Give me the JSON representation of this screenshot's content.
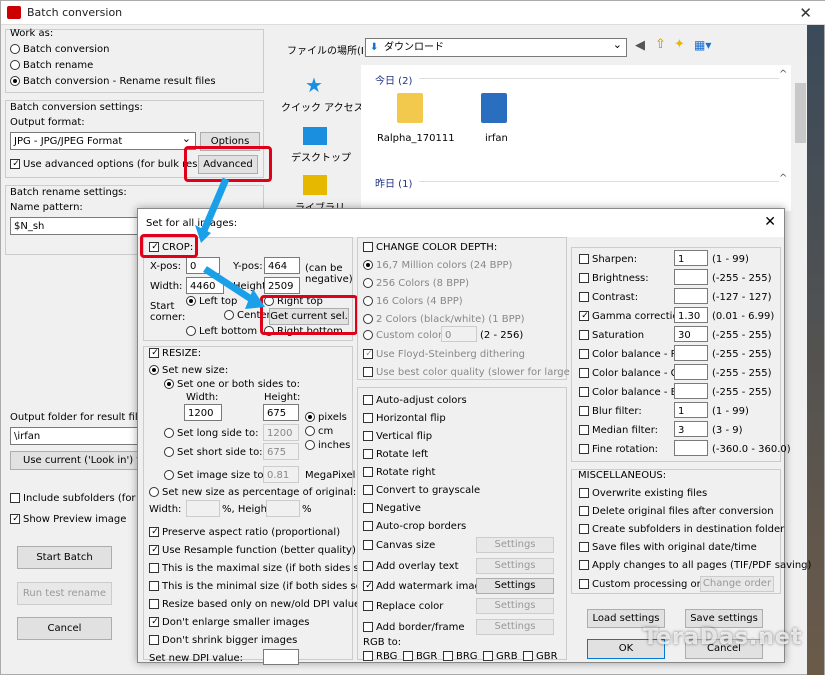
{
  "window": {
    "title": "Batch conversion"
  },
  "main": {
    "work_as": {
      "label": "Work as:",
      "options": [
        "Batch conversion",
        "Batch rename",
        "Batch conversion - Rename result files"
      ],
      "selected": 2
    },
    "conversion_settings": {
      "label": "Batch conversion settings:",
      "output_format_label": "Output format:",
      "output_format": "JPG - JPG/JPEG Format",
      "options_button": "Options",
      "use_advanced": "Use advanced options (for bulk resize...",
      "advanced_button": "Advanced"
    },
    "rename_settings": {
      "label": "Batch rename settings:",
      "name_pattern_label": "Name pattern:",
      "name_pattern": "$N_sh"
    },
    "output_folder": {
      "label": "Output folder for result files: (or p",
      "value": "\\irfan",
      "use_current_button": "Use current ('Look in') folder"
    },
    "include_subfolders": "Include subfolders (for \"Add",
    "show_preview": "Show Preview image",
    "start_button": "Start Batch",
    "run_test_button": "Run test rename",
    "cancel_button": "Cancel"
  },
  "explorer": {
    "location_label": "ファイルの場所(I):",
    "location": "ダウンロード",
    "nav": [
      "クイック アクセス",
      "デスクトップ",
      "ライブラリ"
    ],
    "groups": [
      {
        "label": "今日 (2)"
      },
      {
        "label": "昨日 (1)"
      }
    ],
    "files": [
      "Ralpha_170111",
      "irfan"
    ]
  },
  "dialog": {
    "title": "Set for all images:",
    "crop": {
      "label": "CROP:",
      "xpos_label": "X-pos:",
      "xpos": "0",
      "ypos_label": "Y-pos:",
      "ypos": "464",
      "can_be_negative": "(can be negative)",
      "width_label": "Width:",
      "width": "4460",
      "height_label": "Height:",
      "height": "2509",
      "start_corner_label": "Start corner:",
      "corners": [
        "Left top",
        "Right top",
        "Center",
        "Left bottom",
        "Right bottom"
      ],
      "get_current_button": "Get current sel."
    },
    "resize": {
      "label": "RESIZE:",
      "set_new_size": "Set new size:",
      "set_one_or_both": "Set one or both sides to:",
      "width_label": "Width:",
      "height_label": "Height:",
      "width": "1200",
      "height": "675",
      "units": [
        "pixels",
        "cm",
        "inches"
      ],
      "long_side_label": "Set long side to:",
      "long_side": "1200",
      "short_side_label": "Set short side to:",
      "short_side": "675",
      "image_size_label": "Set image size to:",
      "image_size": "0.81",
      "megapixel": "MegaPixel",
      "percentage_label": "Set new size as percentage of original:",
      "pct_width_label": "Width:",
      "pct_height_label": "%, Height:",
      "pct_suffix": "%"
    },
    "resize_options": [
      "Preserve aspect ratio (proportional)",
      "Use Resample function (better quality)",
      "This is the maximal size (if both sides set)",
      "This is the minimal size (if both sides set)",
      "Resize based only on new/old DPI value",
      "Don't enlarge smaller images",
      "Don't shrink bigger images"
    ],
    "dpi_label": "Set new DPI value:",
    "color_depth": {
      "label": "CHANGE COLOR DEPTH:",
      "options": [
        "16,7 Million colors (24 BPP)",
        "256 Colors (8 BPP)",
        "16 Colors (4 BPP)",
        "2 Colors (black/white) (1 BPP)",
        "Custom colors:"
      ],
      "custom_value": "0",
      "custom_range": "(2 - 256)",
      "floyd": "Use Floyd-Steinberg dithering",
      "best_quality": "Use best color quality (slower for large images)"
    },
    "ops": [
      "Auto-adjust colors",
      "Horizontal flip",
      "Vertical flip",
      "Rotate left",
      "Rotate right",
      "Convert to grayscale",
      "Negative",
      "Auto-crop borders",
      "Canvas size",
      "Add overlay text",
      "Add watermark image",
      "Replace color",
      "Add border/frame"
    ],
    "settings_label": "Settings",
    "rgb_label": "RGB to:",
    "rgb_opts": [
      "RBG",
      "BGR",
      "BRG",
      "GRB",
      "GBR"
    ],
    "adjust": [
      {
        "label": "Sharpen:",
        "value": "1",
        "range": "(1 - 99)"
      },
      {
        "label": "Brightness:",
        "value": "",
        "range": "(-255 - 255)"
      },
      {
        "label": "Contrast:",
        "value": "",
        "range": "(-127 - 127)"
      },
      {
        "label": "Gamma correction:",
        "value": "1.30",
        "range": "(0.01 - 6.99)"
      },
      {
        "label": "Saturation",
        "value": "30",
        "range": "(-255 - 255)"
      },
      {
        "label": "Color balance - R:",
        "value": "",
        "range": "(-255 - 255)"
      },
      {
        "label": "Color balance - G:",
        "value": "",
        "range": "(-255 - 255)"
      },
      {
        "label": "Color balance - B:",
        "value": "",
        "range": "(-255 - 255)"
      },
      {
        "label": "Blur filter:",
        "value": "1",
        "range": "(1 - 99)"
      },
      {
        "label": "Median filter:",
        "value": "3",
        "range": "(3 - 9)"
      },
      {
        "label": "Fine rotation:",
        "value": "",
        "range": "(-360.0 - 360.0)"
      }
    ],
    "misc": {
      "label": "MISCELLANEOUS:",
      "options": [
        "Overwrite existing files",
        "Delete original files after conversion",
        "Create subfolders in destination folder",
        "Save files with original date/time",
        "Apply changes to all pages (TIF/PDF saving)",
        "Custom processing order"
      ],
      "change_order": "Change order"
    },
    "load_settings": "Load settings",
    "save_settings": "Save settings",
    "ok": "OK",
    "cancel": "Cancel"
  },
  "watermark": "TeraDas.net",
  "colors": {
    "highlight": "#e0001a",
    "arrow": "#1aa0e8"
  }
}
